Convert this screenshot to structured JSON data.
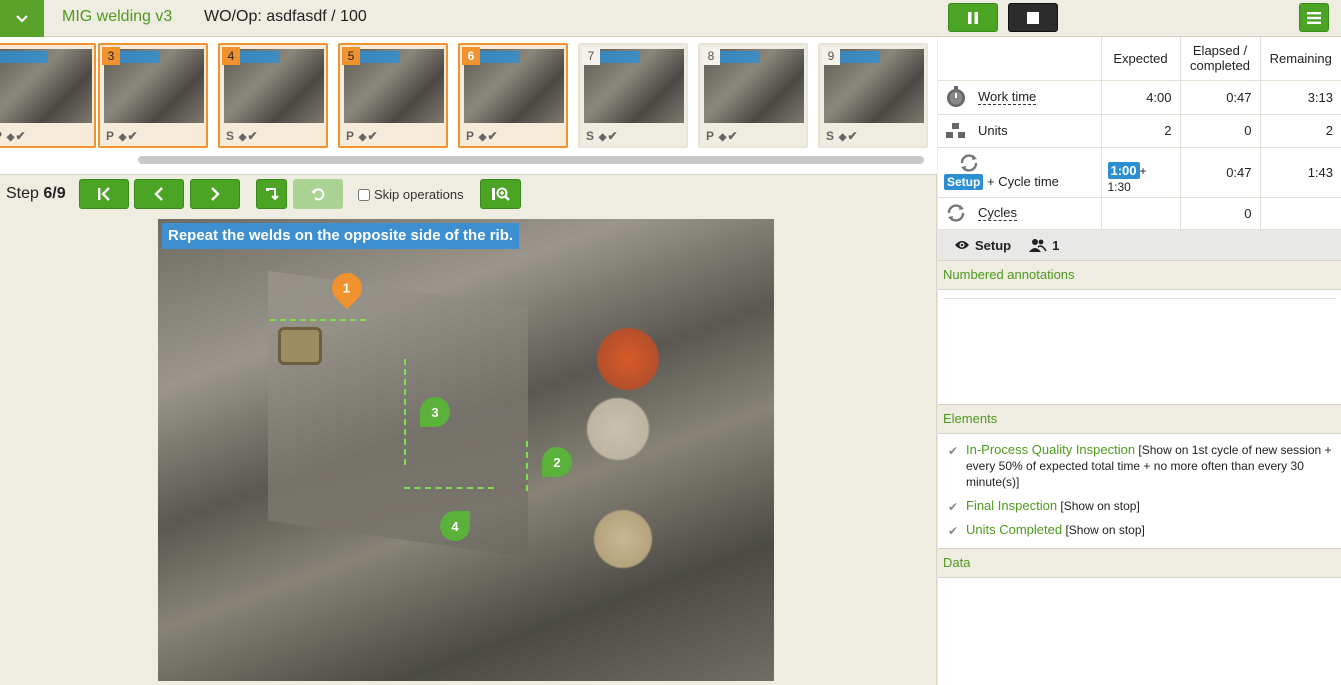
{
  "header": {
    "app_title": "MIG welding v3",
    "wo_label": "WO/Op: asdfasdf / 100",
    "menu_toggle_icon": "chevron-down-icon",
    "pause_icon": "pause-icon",
    "stop_icon": "stop-icon",
    "menu_icon": "hamburger-icon"
  },
  "filmstrip": {
    "thumbs": [
      {
        "num": "",
        "meta": "P",
        "state": "done"
      },
      {
        "num": "3",
        "meta": "P",
        "state": "done"
      },
      {
        "num": "4",
        "meta": "S",
        "state": "done"
      },
      {
        "num": "5",
        "meta": "P",
        "state": "done"
      },
      {
        "num": "6",
        "meta": "P",
        "state": "current"
      },
      {
        "num": "7",
        "meta": "S",
        "state": "pending"
      },
      {
        "num": "8",
        "meta": "P",
        "state": "pending"
      },
      {
        "num": "9",
        "meta": "S",
        "state": "pending"
      }
    ]
  },
  "stepbar": {
    "step_prefix": "Step ",
    "step_value": "6/9",
    "skip_label": "Skip operations"
  },
  "photo": {
    "caption": "Repeat the welds on the opposite side of the rib.",
    "markers": [
      "1",
      "2",
      "3",
      "4"
    ]
  },
  "metrics": {
    "headers": {
      "expected": "Expected",
      "elapsed": "Elapsed / completed",
      "remaining": "Remaining"
    },
    "work_time": {
      "label": "Work time",
      "expected": "4:00",
      "elapsed": "0:47",
      "remaining": "3:13"
    },
    "units": {
      "label": "Units",
      "expected": "2",
      "elapsed": "0",
      "remaining": "2"
    },
    "cycle_time": {
      "setup_label": "Setup",
      "label": "+ Cycle time",
      "expected_setup": "1:00",
      "expected_rest": "+ 1:30",
      "elapsed": "0:47",
      "remaining": "1:43"
    },
    "cycles": {
      "label": "Cycles",
      "expected": "",
      "elapsed": "0",
      "remaining": ""
    }
  },
  "status": {
    "mode": "Setup",
    "operators": "1"
  },
  "sections": {
    "annotations": "Numbered annotations",
    "elements": "Elements",
    "data": "Data"
  },
  "elements": [
    {
      "name": "In-Process Quality Inspection",
      "desc": "[Show on 1st cycle of new session + every 50% of expected total time + no more often than every 30 minute(s)]"
    },
    {
      "name": "Final Inspection",
      "desc": "[Show on stop]"
    },
    {
      "name": "Units Completed",
      "desc": "[Show on stop]"
    }
  ]
}
